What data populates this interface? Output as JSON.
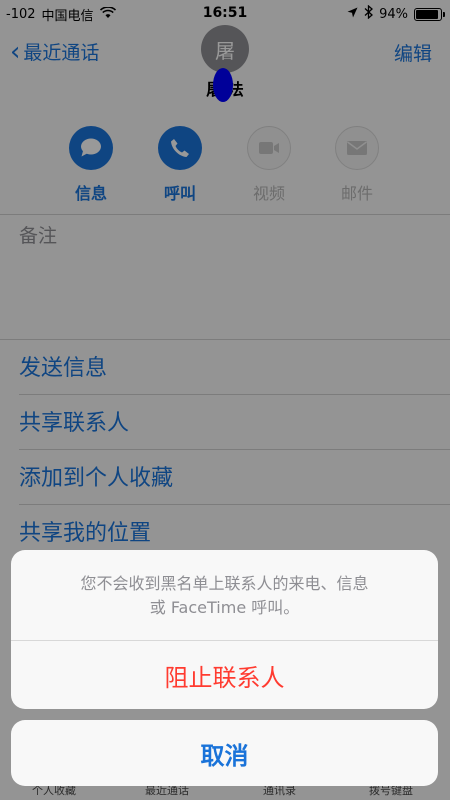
{
  "status_bar": {
    "signal": "-102",
    "carrier": "中国电信",
    "time": "16:51",
    "battery": "94%",
    "battery_level": 0.94
  },
  "nav": {
    "back_label": "最近通话",
    "edit_label": "编辑",
    "avatar_initial": "屠",
    "contact_name": "屠 法"
  },
  "actions": [
    {
      "label": "信息",
      "icon": "message-icon",
      "enabled": true
    },
    {
      "label": "呼叫",
      "icon": "phone-icon",
      "enabled": true
    },
    {
      "label": "视频",
      "icon": "video-icon",
      "enabled": false
    },
    {
      "label": "邮件",
      "icon": "mail-icon",
      "enabled": false
    }
  ],
  "notes_label": "备注",
  "list_items": [
    {
      "label": "发送信息"
    },
    {
      "label": "共享联系人"
    },
    {
      "label": "添加到个人收藏"
    },
    {
      "label": "共享我的位置"
    }
  ],
  "tab_bar": {
    "items": [
      "个人收藏",
      "最近通话",
      "通讯录",
      "拨号键盘"
    ]
  },
  "action_sheet": {
    "message_line1": "您不会收到黑名单上联系人的来电、信息",
    "message_line2": "或 FaceTime 呼叫。",
    "block_label": "阻止联系人",
    "cancel_label": "取消"
  },
  "colors": {
    "accent": "#1a73d9",
    "destructive": "#ff3b30",
    "redaction": "#0000ff"
  }
}
